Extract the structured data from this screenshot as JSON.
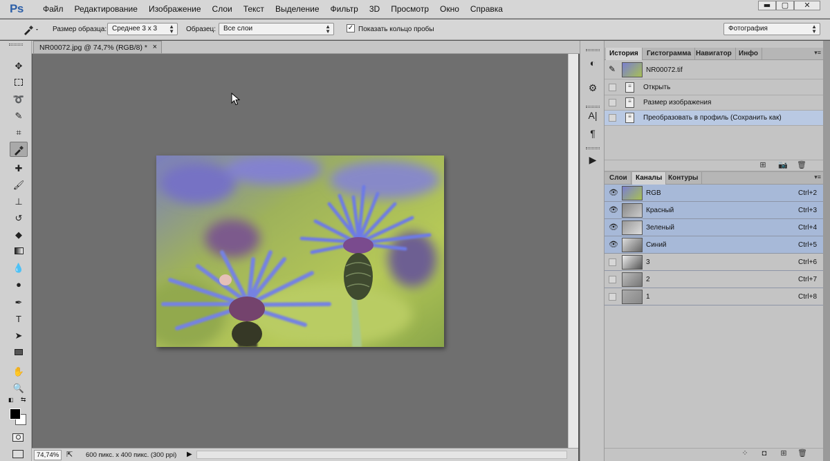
{
  "app": {
    "logo": "Ps"
  },
  "menu": [
    "Файл",
    "Редактирование",
    "Изображение",
    "Слои",
    "Текст",
    "Выделение",
    "Фильтр",
    "3D",
    "Просмотр",
    "Окно",
    "Справка"
  ],
  "window_controls": {
    "minimize": "▬",
    "maximize": "▢",
    "close": "✕"
  },
  "options": {
    "sample_size_label": "Размер образца:",
    "sample_size_value": "Среднее 3 х 3",
    "sample_label": "Образец:",
    "sample_value": "Все слои",
    "ring_check": "✓",
    "ring_label": "Показать кольцо пробы",
    "workspace": "Фотография"
  },
  "document": {
    "tab_title": "NR00072.jpg @ 74,7% (RGB/8) *",
    "close": "×",
    "zoom": "74,74%",
    "info": "600 пикс. x 400 пикс. (300 ppi)"
  },
  "history_panel": {
    "tabs": [
      "История",
      "Гистограмма",
      "Навигатор",
      "Инфо"
    ],
    "snapshot": "NR00072.tif",
    "items": [
      {
        "label": "Открыть",
        "selected": false
      },
      {
        "label": "Размер изображения",
        "selected": false
      },
      {
        "label": "Преобразовать в профиль (Сохранить как)",
        "selected": true
      }
    ]
  },
  "channels_panel": {
    "tabs": [
      "Слои",
      "Каналы",
      "Контуры"
    ],
    "channels": [
      {
        "name": "RGB",
        "shortcut": "Ctrl+2",
        "visible": true,
        "color": true
      },
      {
        "name": "Красный",
        "shortcut": "Ctrl+3",
        "visible": true,
        "color": false
      },
      {
        "name": "Зеленый",
        "shortcut": "Ctrl+4",
        "visible": true,
        "color": false
      },
      {
        "name": "Синий",
        "shortcut": "Ctrl+5",
        "visible": true,
        "color": false
      },
      {
        "name": "3",
        "shortcut": "Ctrl+6",
        "visible": false,
        "color": false
      },
      {
        "name": "2",
        "shortcut": "Ctrl+7",
        "visible": false,
        "color": false
      },
      {
        "name": "1",
        "shortcut": "Ctrl+8",
        "visible": false,
        "color": false
      }
    ]
  },
  "colors": {
    "selection": "#a7b9d8",
    "history_selection": "#b9c9e3",
    "flower": "#6f7ee0",
    "background_green": "#a8c24a"
  }
}
